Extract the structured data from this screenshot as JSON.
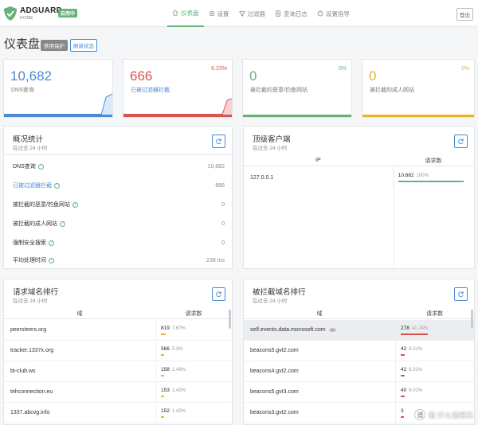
{
  "header": {
    "brand": "ADGUARD",
    "brand_sub": "HOME",
    "status_badge": "启用中",
    "nav": [
      {
        "label": "仪表盘",
        "icon": "home-icon",
        "active": true
      },
      {
        "label": "设置",
        "icon": "gear-icon",
        "active": false
      },
      {
        "label": "过滤器",
        "icon": "filter-icon",
        "active": false
      },
      {
        "label": "查询日志",
        "icon": "log-icon",
        "active": false
      },
      {
        "label": "设置指导",
        "icon": "help-icon",
        "active": false
      }
    ],
    "logout": "登出"
  },
  "page": {
    "title": "仪表盘",
    "disable_protection": "禁用保护",
    "refresh_status": "刷新状态"
  },
  "stat_cards": [
    {
      "value": "10,682",
      "label": "DNS查询",
      "percent": "",
      "color": "#4a8ad6"
    },
    {
      "value": "666",
      "label": "已被过滤器拦截",
      "percent": "6.23%",
      "color": "#d9534f"
    },
    {
      "value": "0",
      "label": "被拦截的恶意/钓鱼网站",
      "percent": "0%",
      "color": "#67b279"
    },
    {
      "value": "0",
      "label": "被拦截的成人网站",
      "percent": "0%",
      "color": "#e6b52e"
    }
  ],
  "overview": {
    "title": "概况统计",
    "subtitle": "在过去 24 小时",
    "rows": [
      {
        "label": "DNS查询",
        "value": "10,682"
      },
      {
        "label": "已被过滤器拦截",
        "value": "666"
      },
      {
        "label": "被拦截的恶意/钓鱼网站",
        "value": "0"
      },
      {
        "label": "被拦截的成人网站",
        "value": "0"
      },
      {
        "label": "强制安全搜索",
        "value": "0"
      },
      {
        "label": "平均处理时间",
        "value": "238 ms"
      }
    ]
  },
  "top_clients": {
    "title": "顶级客户端",
    "subtitle": "在过去 24 小时",
    "col_ip": "IP",
    "col_requests": "请求数",
    "rows": [
      {
        "ip": "127.0.0.1",
        "count": "10,682",
        "percent": "100%",
        "fraction": 1.0
      }
    ]
  },
  "top_queried": {
    "title": "请求域名排行",
    "subtitle": "在过去 24 小时",
    "col_domain": "域",
    "col_requests": "请求数",
    "rows": [
      {
        "domain": "peersteers.org",
        "count": "819",
        "percent": "7.67%",
        "fraction": 0.0767
      },
      {
        "domain": "tracker.1337x.org",
        "count": "566",
        "percent": "5.3%",
        "fraction": 0.053
      },
      {
        "domain": "bt-club.ws",
        "count": "158",
        "percent": "1.48%",
        "fraction": 0.0148
      },
      {
        "domain": "tehconnection.eu",
        "count": "153",
        "percent": "1.43%",
        "fraction": 0.0143
      },
      {
        "domain": "1337.abcvg.info",
        "count": "152",
        "percent": "1.42%",
        "fraction": 0.0142
      }
    ]
  },
  "top_blocked": {
    "title": "被拦截域名排行",
    "subtitle": "在过去 24 小时",
    "col_domain": "域",
    "col_requests": "请求数",
    "rows": [
      {
        "domain": "self.events.data.microsoft.com",
        "count": "278",
        "percent": "41.74%",
        "fraction": 0.4174
      },
      {
        "domain": "beacons5.gvt2.com",
        "count": "42",
        "percent": "6.31%",
        "fraction": 0.0631
      },
      {
        "domain": "beacons4.gvt2.com",
        "count": "42",
        "percent": "6.31%",
        "fraction": 0.0631
      },
      {
        "domain": "beacons5.gvt3.com",
        "count": "40",
        "percent": "6.01%",
        "fraction": 0.0601
      },
      {
        "domain": "beacons3.gvt2.com",
        "count": "3",
        "percent": "",
        "fraction": 0.005
      }
    ]
  },
  "watermark": "值 什么值得买"
}
